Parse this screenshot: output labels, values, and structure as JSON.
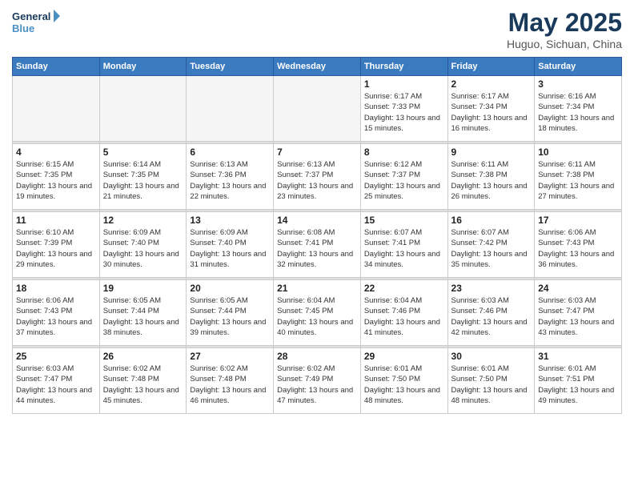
{
  "header": {
    "logo_line1": "General",
    "logo_line2": "Blue",
    "month": "May 2025",
    "location": "Huguo, Sichuan, China"
  },
  "weekdays": [
    "Sunday",
    "Monday",
    "Tuesday",
    "Wednesday",
    "Thursday",
    "Friday",
    "Saturday"
  ],
  "weeks": [
    [
      {
        "day": "",
        "info": ""
      },
      {
        "day": "",
        "info": ""
      },
      {
        "day": "",
        "info": ""
      },
      {
        "day": "",
        "info": ""
      },
      {
        "day": "1",
        "info": "Sunrise: 6:17 AM\nSunset: 7:33 PM\nDaylight: 13 hours\nand 15 minutes."
      },
      {
        "day": "2",
        "info": "Sunrise: 6:17 AM\nSunset: 7:34 PM\nDaylight: 13 hours\nand 16 minutes."
      },
      {
        "day": "3",
        "info": "Sunrise: 6:16 AM\nSunset: 7:34 PM\nDaylight: 13 hours\nand 18 minutes."
      }
    ],
    [
      {
        "day": "4",
        "info": "Sunrise: 6:15 AM\nSunset: 7:35 PM\nDaylight: 13 hours\nand 19 minutes."
      },
      {
        "day": "5",
        "info": "Sunrise: 6:14 AM\nSunset: 7:35 PM\nDaylight: 13 hours\nand 21 minutes."
      },
      {
        "day": "6",
        "info": "Sunrise: 6:13 AM\nSunset: 7:36 PM\nDaylight: 13 hours\nand 22 minutes."
      },
      {
        "day": "7",
        "info": "Sunrise: 6:13 AM\nSunset: 7:37 PM\nDaylight: 13 hours\nand 23 minutes."
      },
      {
        "day": "8",
        "info": "Sunrise: 6:12 AM\nSunset: 7:37 PM\nDaylight: 13 hours\nand 25 minutes."
      },
      {
        "day": "9",
        "info": "Sunrise: 6:11 AM\nSunset: 7:38 PM\nDaylight: 13 hours\nand 26 minutes."
      },
      {
        "day": "10",
        "info": "Sunrise: 6:11 AM\nSunset: 7:38 PM\nDaylight: 13 hours\nand 27 minutes."
      }
    ],
    [
      {
        "day": "11",
        "info": "Sunrise: 6:10 AM\nSunset: 7:39 PM\nDaylight: 13 hours\nand 29 minutes."
      },
      {
        "day": "12",
        "info": "Sunrise: 6:09 AM\nSunset: 7:40 PM\nDaylight: 13 hours\nand 30 minutes."
      },
      {
        "day": "13",
        "info": "Sunrise: 6:09 AM\nSunset: 7:40 PM\nDaylight: 13 hours\nand 31 minutes."
      },
      {
        "day": "14",
        "info": "Sunrise: 6:08 AM\nSunset: 7:41 PM\nDaylight: 13 hours\nand 32 minutes."
      },
      {
        "day": "15",
        "info": "Sunrise: 6:07 AM\nSunset: 7:41 PM\nDaylight: 13 hours\nand 34 minutes."
      },
      {
        "day": "16",
        "info": "Sunrise: 6:07 AM\nSunset: 7:42 PM\nDaylight: 13 hours\nand 35 minutes."
      },
      {
        "day": "17",
        "info": "Sunrise: 6:06 AM\nSunset: 7:43 PM\nDaylight: 13 hours\nand 36 minutes."
      }
    ],
    [
      {
        "day": "18",
        "info": "Sunrise: 6:06 AM\nSunset: 7:43 PM\nDaylight: 13 hours\nand 37 minutes."
      },
      {
        "day": "19",
        "info": "Sunrise: 6:05 AM\nSunset: 7:44 PM\nDaylight: 13 hours\nand 38 minutes."
      },
      {
        "day": "20",
        "info": "Sunrise: 6:05 AM\nSunset: 7:44 PM\nDaylight: 13 hours\nand 39 minutes."
      },
      {
        "day": "21",
        "info": "Sunrise: 6:04 AM\nSunset: 7:45 PM\nDaylight: 13 hours\nand 40 minutes."
      },
      {
        "day": "22",
        "info": "Sunrise: 6:04 AM\nSunset: 7:46 PM\nDaylight: 13 hours\nand 41 minutes."
      },
      {
        "day": "23",
        "info": "Sunrise: 6:03 AM\nSunset: 7:46 PM\nDaylight: 13 hours\nand 42 minutes."
      },
      {
        "day": "24",
        "info": "Sunrise: 6:03 AM\nSunset: 7:47 PM\nDaylight: 13 hours\nand 43 minutes."
      }
    ],
    [
      {
        "day": "25",
        "info": "Sunrise: 6:03 AM\nSunset: 7:47 PM\nDaylight: 13 hours\nand 44 minutes."
      },
      {
        "day": "26",
        "info": "Sunrise: 6:02 AM\nSunset: 7:48 PM\nDaylight: 13 hours\nand 45 minutes."
      },
      {
        "day": "27",
        "info": "Sunrise: 6:02 AM\nSunset: 7:48 PM\nDaylight: 13 hours\nand 46 minutes."
      },
      {
        "day": "28",
        "info": "Sunrise: 6:02 AM\nSunset: 7:49 PM\nDaylight: 13 hours\nand 47 minutes."
      },
      {
        "day": "29",
        "info": "Sunrise: 6:01 AM\nSunset: 7:50 PM\nDaylight: 13 hours\nand 48 minutes."
      },
      {
        "day": "30",
        "info": "Sunrise: 6:01 AM\nSunset: 7:50 PM\nDaylight: 13 hours\nand 48 minutes."
      },
      {
        "day": "31",
        "info": "Sunrise: 6:01 AM\nSunset: 7:51 PM\nDaylight: 13 hours\nand 49 minutes."
      }
    ]
  ]
}
